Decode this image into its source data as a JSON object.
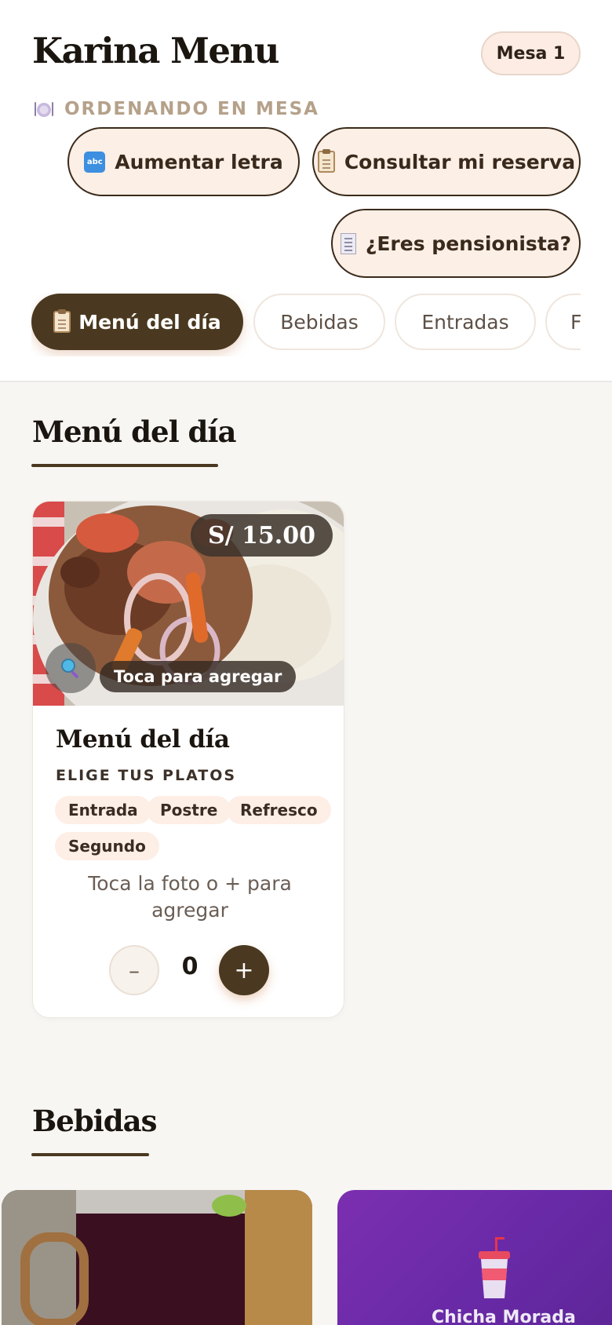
{
  "header": {
    "title": "Karina Menu",
    "table_badge": "Mesa 1",
    "subtitle": "ORDENANDO EN MESA",
    "buttons": {
      "font_size": "Aumentar letra",
      "reservation": "Consultar mi reserva",
      "pensioner": "¿Eres pensionista?"
    },
    "tabs": [
      {
        "label": "Menú del día",
        "active": true
      },
      {
        "label": "Bebidas",
        "active": false
      },
      {
        "label": "Entradas",
        "active": false
      },
      {
        "label": "F",
        "active": false
      }
    ]
  },
  "sections": {
    "menu": {
      "title": "Menú del día",
      "card": {
        "price": "S/ 15.00",
        "tap_hint": "Toca para agregar",
        "name": "Menú del día",
        "subtitle": "ELIGE TUS PLATOS",
        "chips": [
          "Entrada",
          "Postre",
          "Refresco",
          "Segundo"
        ],
        "hint": "Toca la foto o + para agregar",
        "minus": "–",
        "quantity": "0",
        "plus": "+"
      }
    },
    "drinks": {
      "title": "Bebidas",
      "items": [
        {
          "name": ""
        },
        {
          "name": "Chicha Morada"
        }
      ]
    }
  },
  "icons": {
    "plate": "plate-icon",
    "abc": "abc-icon",
    "clipboard": "clipboard-icon",
    "receipt": "receipt-icon",
    "search": "magnifier-icon",
    "cup": "cup-icon"
  },
  "colors": {
    "accent": "#4a3920",
    "pill_bg": "#fcefe6",
    "muted_gold": "#b5a18a",
    "drink_purple": "#6a2aa8"
  }
}
